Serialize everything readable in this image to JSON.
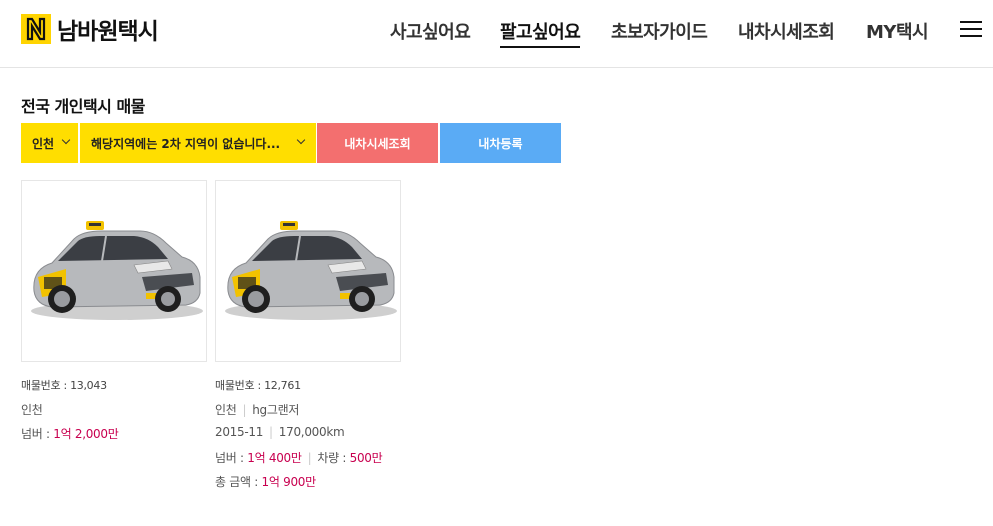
{
  "brand": {
    "name": "남바원택시",
    "logo_letter": "N",
    "accent": "#ffd400"
  },
  "nav": {
    "items": [
      {
        "label": "사고싶어요",
        "active": false
      },
      {
        "label": "팔고싶어요",
        "active": true
      },
      {
        "label": "초보자가이드",
        "active": false
      },
      {
        "label": "내차시세조회",
        "active": false
      },
      {
        "label": "MY택시",
        "active": false
      }
    ],
    "menu_icon": "hamburger-icon"
  },
  "section": {
    "title": "전국 개인택시 매물"
  },
  "filters": {
    "region": "인천",
    "subregion": "해당지역에는 2차 지역이 없습니다...",
    "price_button": "내차시세조회",
    "register_button": "내차등록"
  },
  "colors": {
    "select": "#ffde00",
    "price_button": "#f36f6f",
    "register_button": "#5aabf5",
    "price_text": "#c8004f"
  },
  "listings": [
    {
      "number": "매물번호 : 13,043",
      "region": "인천",
      "premium_label": "넘버 : ",
      "premium_value": "1억 2,000만"
    },
    {
      "number": "매물번호 : 12,761",
      "region": "인천",
      "model": "hg그랜저",
      "year": "2015-11",
      "mileage": "170,000km",
      "premium_label": "넘버 : ",
      "premium_value": "1억 400만",
      "vehicle_label": "차량 : ",
      "vehicle_value": "500만",
      "total_label": "총 금액 : ",
      "total_value": "1억 900만"
    }
  ]
}
